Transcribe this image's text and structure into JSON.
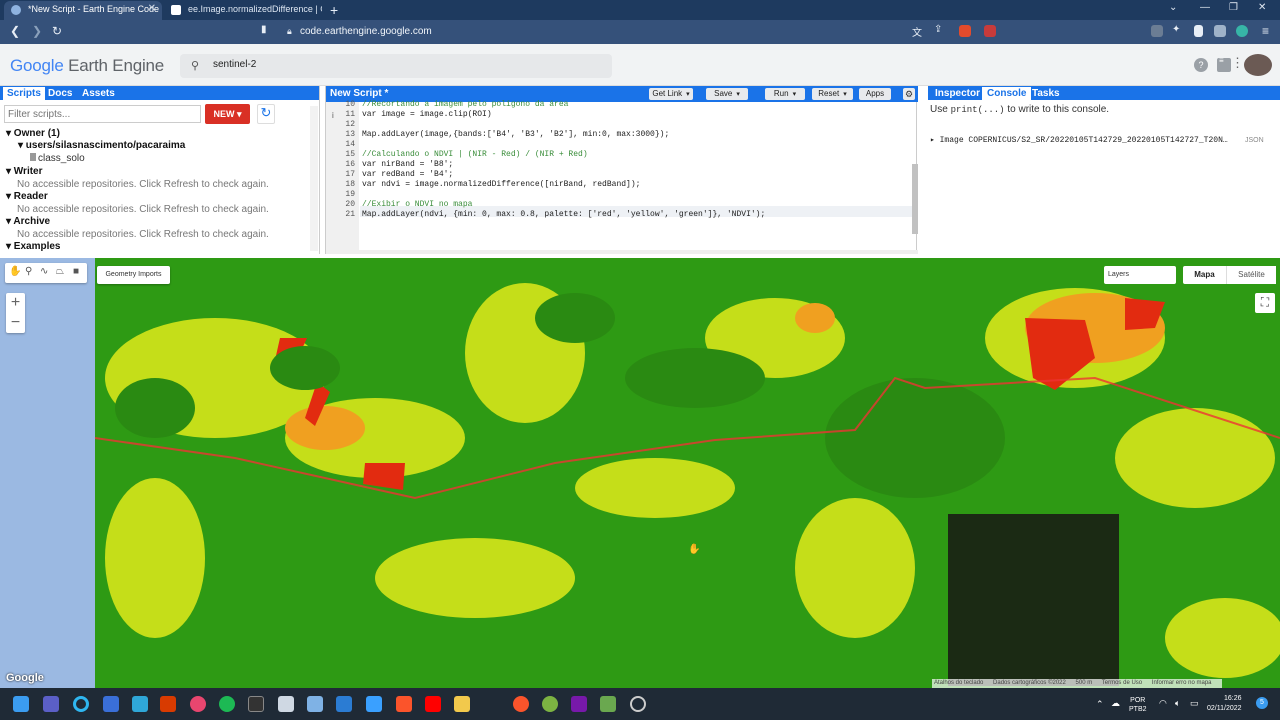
{
  "browser": {
    "tabs": [
      {
        "title": "*New Script - Earth Engine Code"
      },
      {
        "title": "ee.Image.normalizedDifference | Goo"
      }
    ],
    "new_tab_symbol": "+",
    "url": "code.earthengine.google.com"
  },
  "header": {
    "logo_word1": "Google",
    "logo_word2": "Earth Engine",
    "search_value": "sentinel-2",
    "help_icon": "?",
    "feedback_icon": "speech-bubble",
    "apps_icon": "grid"
  },
  "left_panel": {
    "tabs": [
      "Scripts",
      "Docs",
      "Assets"
    ],
    "filter_placeholder": "Filter scripts...",
    "new_button": "NEW",
    "tree": [
      {
        "label": "▾ Owner (1)",
        "style": "bold"
      },
      {
        "label": "▾ users/silasnascimento/pacaraima",
        "style": "bold"
      },
      {
        "label": "class_solo",
        "style": "file"
      },
      {
        "label": "▾ Writer",
        "style": "bold"
      },
      {
        "label": "No accessible repositories. Click Refresh to check again.",
        "style": "note"
      },
      {
        "label": "▾ Reader",
        "style": "bold"
      },
      {
        "label": "No accessible repositories. Click Refresh to check again.",
        "style": "note"
      },
      {
        "label": "▾ Archive",
        "style": "bold"
      },
      {
        "label": "No accessible repositories. Click Refresh to check again.",
        "style": "note"
      },
      {
        "label": "▾ Examples",
        "style": "bold"
      }
    ]
  },
  "editor": {
    "title": "New Script *",
    "buttons": {
      "get_link": "Get Link",
      "save": "Save",
      "run": "Run",
      "reset": "Reset",
      "apps": "Apps"
    },
    "lines": [
      {
        "n": "10",
        "text": "//Recortando a imagem pelo polígono da área"
      },
      {
        "n": "11",
        "text": "var image = image.clip(ROI)"
      },
      {
        "n": "12",
        "text": ""
      },
      {
        "n": "13",
        "text": "Map.addLayer(image,{bands:['B4', 'B3', 'B2'], min:0, max:3000});"
      },
      {
        "n": "14",
        "text": ""
      },
      {
        "n": "15",
        "text": "//Calculando o NDVI | (NIR - Red) / (NIR + Red)"
      },
      {
        "n": "16",
        "text": "var nirBand = 'B8';"
      },
      {
        "n": "17",
        "text": "var redBand = 'B4';"
      },
      {
        "n": "18",
        "text": "var ndvi = image.normalizedDifference([nirBand, redBand]);"
      },
      {
        "n": "19",
        "text": ""
      },
      {
        "n": "20",
        "text": "//Exibir o NDVI no mapa"
      },
      {
        "n": "21",
        "text": "Map.addLayer(ndvi, {min: 0, max: 0.8, palette: ['red', 'yellow', 'green']}, 'NDVI');"
      }
    ]
  },
  "right_panel": {
    "tabs": [
      "Inspector",
      "Console",
      "Tasks"
    ],
    "hint_prefix": "Use ",
    "hint_code": "print(...)",
    "hint_suffix": " to write to this console.",
    "image_line": "▸ Image COPERNICUS/S2_SR/20220105T142729_20220105T142727_T20N…",
    "json_label": "JSON"
  },
  "map": {
    "geometry_imports": "Geometry Imports",
    "layers": "Layers",
    "map_button": "Mapa",
    "satellite_button": "Satélite",
    "zoom_in": "+",
    "zoom_out": "−",
    "google_logo": "Google",
    "attribution": [
      "Atalhos do teclado",
      "Dados cartográficos ©2022",
      "500 m",
      "Termos de Uso",
      "Informar erro no mapa"
    ]
  },
  "taskbar": {
    "lang1": "POR",
    "lang2": "PTB2",
    "time": "16:26",
    "date": "02/11/2022",
    "notif": "5"
  },
  "colors": {
    "chrome_dark": "#1e3a5f",
    "gee_blue": "#1a73e8",
    "new_red": "#d93025",
    "ndvi_green": "#2e9a14",
    "ndvi_yellow": "#e8e000",
    "ndvi_red": "#e22b10"
  }
}
